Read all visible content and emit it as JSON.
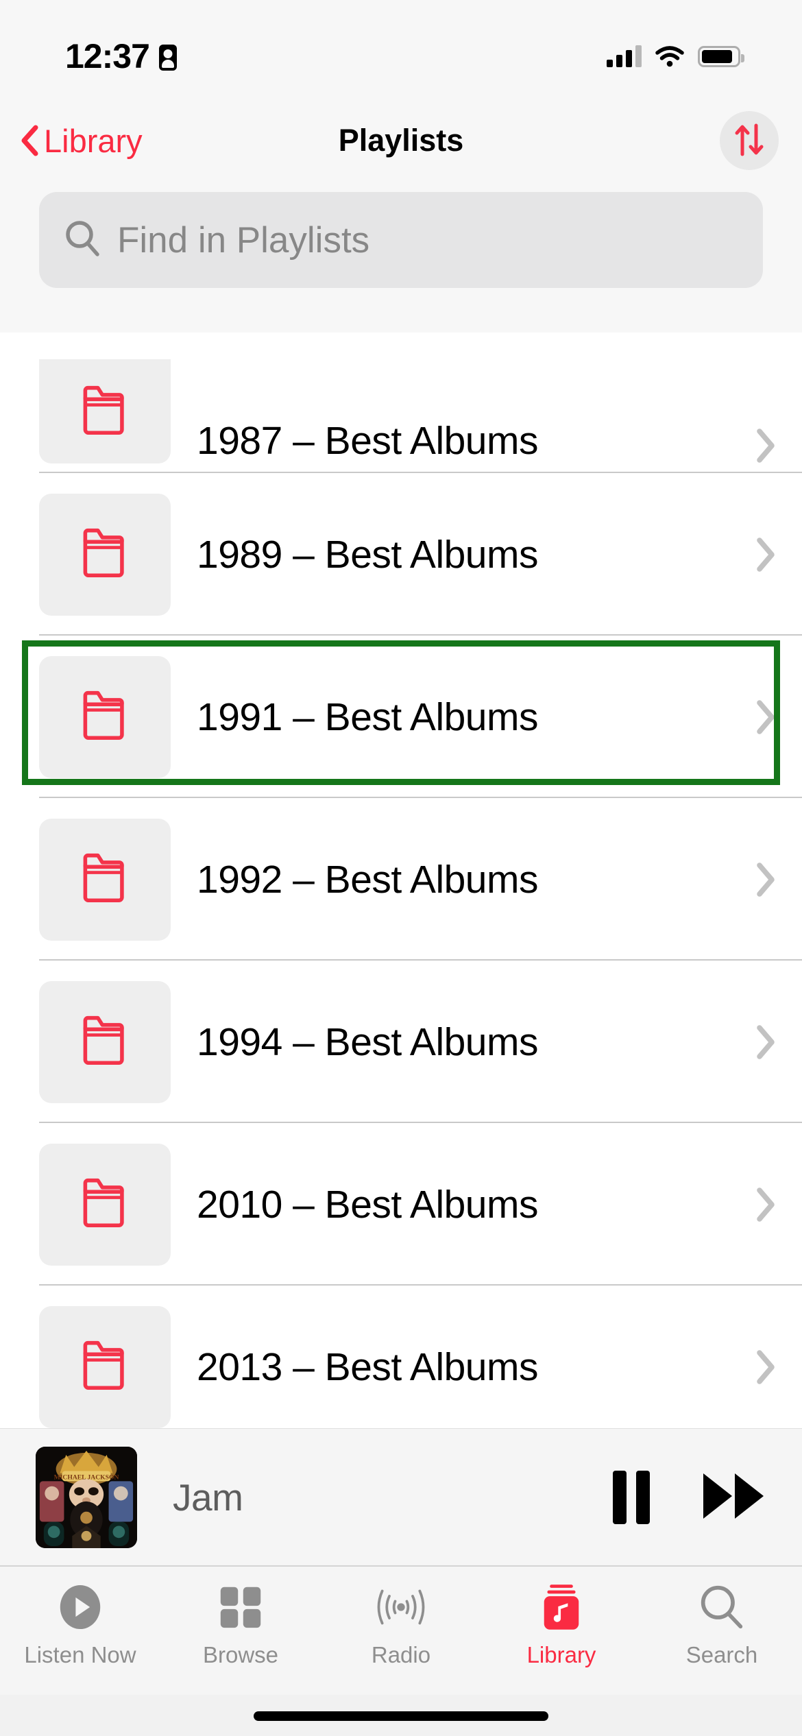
{
  "status_bar": {
    "time": "12:37",
    "recording_icon": "screen-record-icon",
    "cellular_icon": "cellular-signal-icon",
    "cellular_bars_filled": 3,
    "cellular_bars_total": 4,
    "wifi_icon": "wifi-icon",
    "battery_icon": "battery-icon",
    "battery_level_pct": 88
  },
  "nav": {
    "back_label": "Library",
    "back_icon": "chevron-left-icon",
    "title": "Playlists",
    "sort_icon": "sort-arrows-icon",
    "accent_color": "#fa2b42"
  },
  "search": {
    "placeholder": "Find in Playlists",
    "value": "",
    "icon": "search-icon"
  },
  "list": {
    "folder_icon": "folder-icon",
    "chevron_icon": "chevron-right-icon",
    "rows": [
      {
        "title": "1987 – Best Albums"
      },
      {
        "title": "1989 – Best Albums"
      },
      {
        "title": "1991 – Best Albums"
      },
      {
        "title": "1992 – Best Albums"
      },
      {
        "title": "1994 – Best Albums"
      },
      {
        "title": "2010 – Best Albums"
      },
      {
        "title": "2013 – Best Albums"
      }
    ]
  },
  "highlight": {
    "target_row_title": "1991 – Best Albums",
    "color": "#15761a"
  },
  "now_playing": {
    "track_title": "Jam",
    "artwork_name": "album-artwork",
    "pause_icon": "pause-icon",
    "next_icon": "fast-forward-icon"
  },
  "tab_bar": {
    "active": "Library",
    "items": [
      {
        "label": "Listen Now",
        "icon": "play-circle-icon"
      },
      {
        "label": "Browse",
        "icon": "grid-squares-icon"
      },
      {
        "label": "Radio",
        "icon": "radio-waves-icon"
      },
      {
        "label": "Library",
        "icon": "music-library-icon"
      },
      {
        "label": "Search",
        "icon": "search-icon"
      }
    ]
  }
}
